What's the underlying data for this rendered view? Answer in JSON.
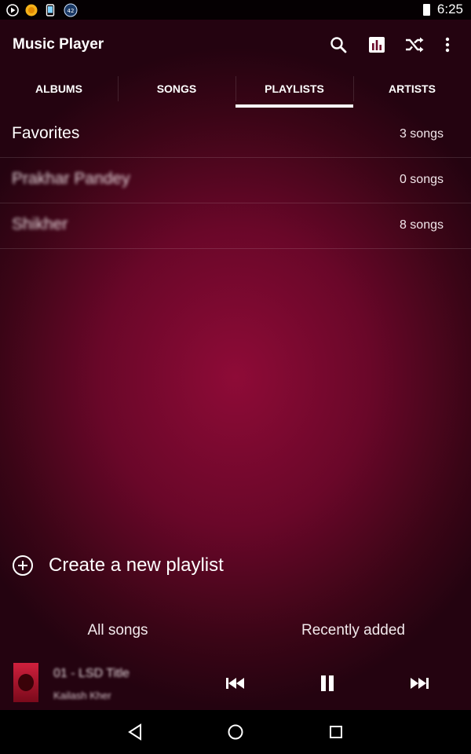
{
  "status_bar": {
    "time": "6:25",
    "notification_badge": "42",
    "icons": [
      "play-circle-icon",
      "coin-icon",
      "phone-icon",
      "badge-icon",
      "battery-icon"
    ]
  },
  "toolbar": {
    "title": "Music Player",
    "actions": [
      "search-icon",
      "equalizer-icon",
      "shuffle-icon",
      "more-vert-icon"
    ]
  },
  "tabs": [
    {
      "label": "ALBUMS",
      "active": false
    },
    {
      "label": "SONGS",
      "active": false
    },
    {
      "label": "PLAYLISTS",
      "active": true
    },
    {
      "label": "ARTISTS",
      "active": false
    }
  ],
  "playlists": [
    {
      "name": "Favorites",
      "count": "3 songs"
    },
    {
      "name": "Prakhar Pandey",
      "count": "0 songs"
    },
    {
      "name": "Shikher",
      "count": "8 songs"
    }
  ],
  "create_playlist": {
    "label": "Create a new playlist",
    "icon": "add-circle-icon"
  },
  "shortcuts": {
    "all_songs": "All songs",
    "recently_added": "Recently added"
  },
  "now_playing": {
    "title": "01 - LSD Title",
    "artist": "Kailash Kher",
    "state": "playing",
    "controls": [
      "previous-icon",
      "pause-icon",
      "next-icon"
    ]
  },
  "nav_bar": [
    "back-icon",
    "home-icon",
    "recents-icon"
  ],
  "colors": {
    "accent": "#ffffff",
    "background_center": "#8e0b37",
    "background_edge": "#240310"
  }
}
